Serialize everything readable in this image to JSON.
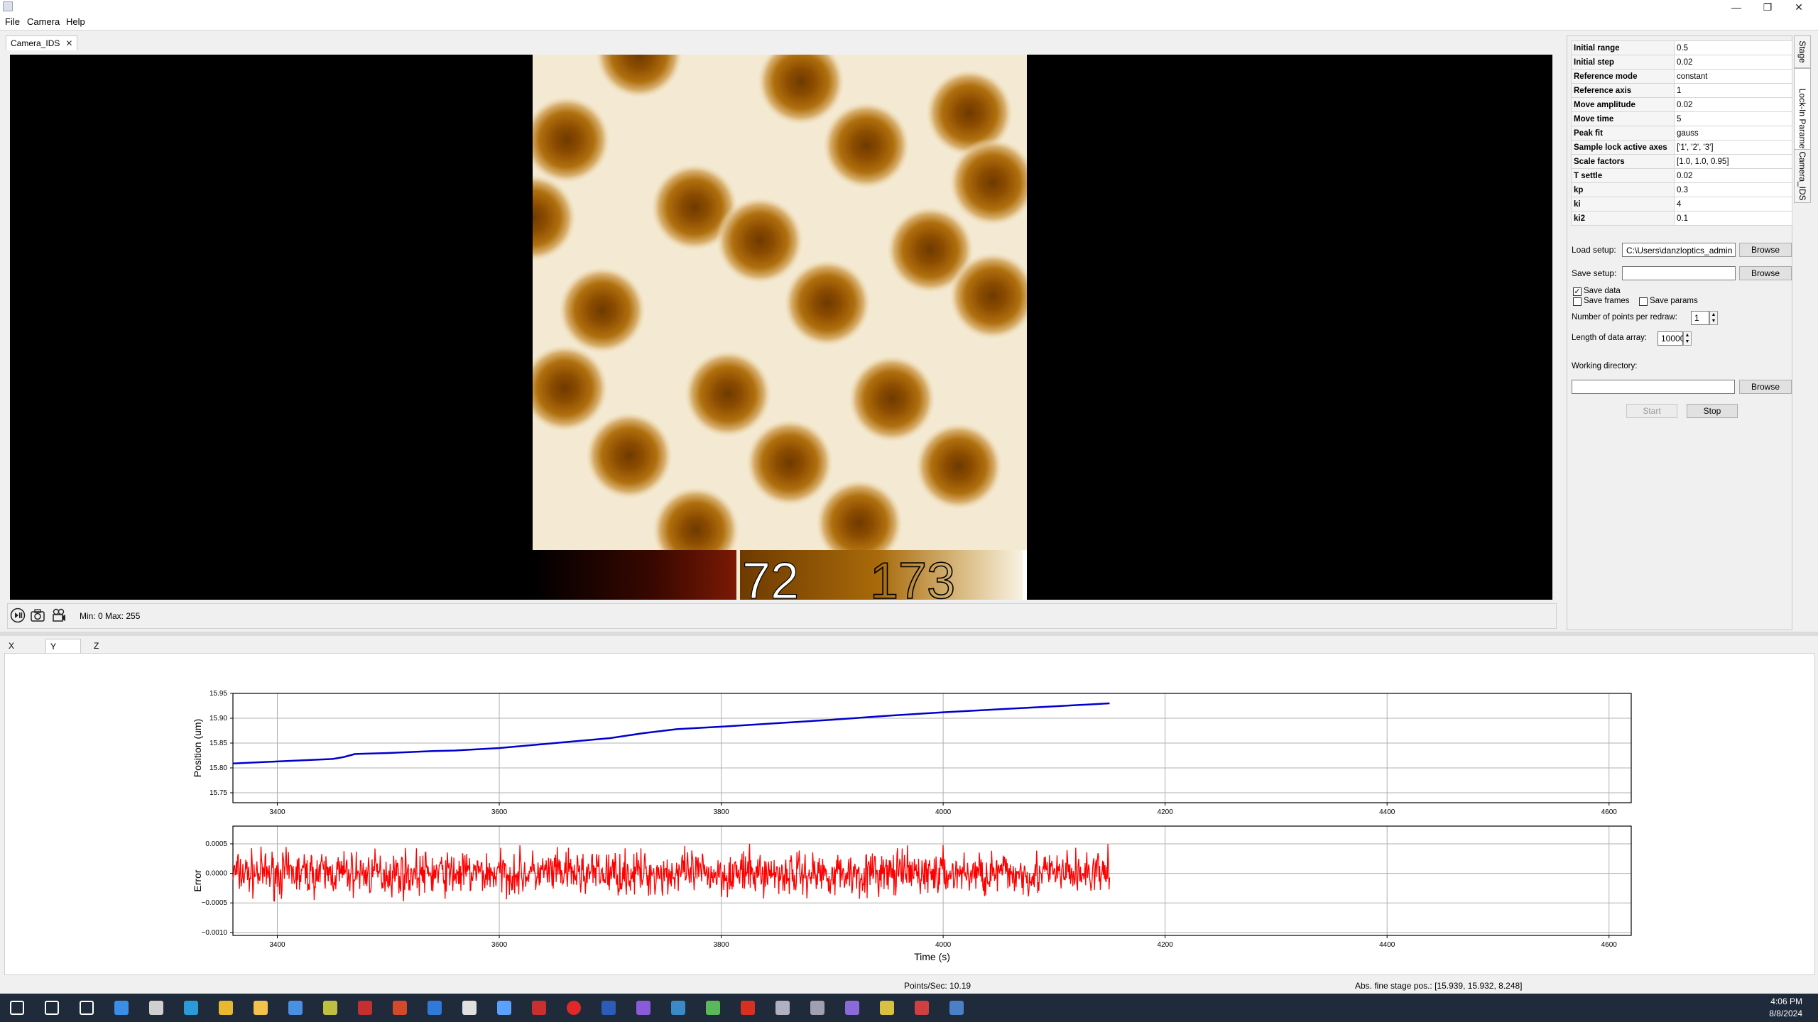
{
  "menu": {
    "file": "File",
    "camera": "Camera",
    "help": "Help"
  },
  "window_controls": {
    "minimize": "—",
    "restore": "❐",
    "close": "✕"
  },
  "camera": {
    "tab_label": "Camera_IDS",
    "tab_close": "✕",
    "colorbar_min_label": "72",
    "colorbar_max_label": "173",
    "min_max_text": "Min: 0 Max: 255"
  },
  "side_tabs": [
    "Stage",
    "Lock-In Parameters",
    "Camera_IDS"
  ],
  "params": [
    {
      "key": "Initial range",
      "value": "0.5"
    },
    {
      "key": "Initial step",
      "value": "0.02"
    },
    {
      "key": "Reference mode",
      "value": "constant"
    },
    {
      "key": "Reference axis",
      "value": "1"
    },
    {
      "key": "Move amplitude",
      "value": "0.02"
    },
    {
      "key": "Move time",
      "value": "5"
    },
    {
      "key": "Peak fit",
      "value": "gauss"
    },
    {
      "key": "Sample lock active axes",
      "value": "['1', '2', '3']"
    },
    {
      "key": "Scale factors",
      "value": "[1.0, 1.0, 0.95]"
    },
    {
      "key": "T settle",
      "value": "0.02"
    },
    {
      "key": "kp",
      "value": "0.3"
    },
    {
      "key": "ki",
      "value": "4"
    },
    {
      "key": "ki2",
      "value": "0.1"
    }
  ],
  "controls": {
    "load_setup_label": "Load setup:",
    "load_setup_value": "C:\\Users\\danzloptics_admin",
    "save_setup_label": "Save setup:",
    "save_setup_value": "",
    "browse": "Browse",
    "save_data": "Save data",
    "save_frames": "Save frames",
    "save_params": "Save params",
    "points_per_redraw_label": "Number of points per redraw:",
    "points_per_redraw": "1",
    "data_array_label": "Length of data array:",
    "data_array": "10000",
    "working_dir_label": "Working directory:",
    "working_dir_value": "",
    "start": "Start",
    "stop": "Stop",
    "save_data_checked": true,
    "save_frames_checked": false,
    "save_params_checked": false
  },
  "plot_tabs": [
    "X Coord.",
    "Y Coord.",
    "Z Coord."
  ],
  "active_plot_tab": 1,
  "status": {
    "points_per_sec": "Points/Sec: 10.19",
    "abs_pos": "Abs. fine stage pos.: [15.939, 15.932, 8.248]"
  },
  "clock": {
    "time": "4:06 PM",
    "date": "8/8/2024"
  },
  "taskbar_icons": [
    "start-icon",
    "search-icon",
    "task-view-icon",
    "app-icon",
    "terminal-icon",
    "edge-icon",
    "chrome-icon",
    "file-explorer-icon",
    "store-icon",
    "app-icon",
    "app-icon",
    "app-icon",
    "vscode-icon",
    "settings-icon",
    "link-icon",
    "app-icon",
    "red-dot-icon",
    "word-icon",
    "visual-studio-icon",
    "app-icon",
    "app-icon",
    "acrobat-icon",
    "app-icon",
    "app-icon",
    "github-icon",
    "app-icon",
    "app-icon",
    "python-icon"
  ],
  "colors": {
    "position_line": "#0000cc",
    "error_line": "#ff0000",
    "taskbar": "#1f2a3a"
  },
  "chart_data": [
    {
      "type": "line",
      "title": "",
      "xlabel": "",
      "ylabel": "Position (um)",
      "xlim": [
        3360,
        4620
      ],
      "ylim": [
        15.73,
        15.95
      ],
      "xticks": [
        3400,
        3600,
        3800,
        4000,
        4200,
        4400,
        4600
      ],
      "yticks": [
        "15.95",
        "15.90",
        "15.85",
        "15.80",
        "15.75"
      ],
      "grid": true,
      "series": [
        {
          "x": [
            3360,
            3400,
            3450,
            3460,
            3470,
            3500,
            3540,
            3560,
            3600,
            3650,
            3700,
            3730,
            3760,
            3800,
            3850,
            3900,
            3950,
            4000,
            4050,
            4100,
            4150
          ],
          "y": [
            15.809,
            15.813,
            15.818,
            15.822,
            15.828,
            15.83,
            15.834,
            15.835,
            15.84,
            15.85,
            15.86,
            15.87,
            15.878,
            15.883,
            15.89,
            15.897,
            15.905,
            15.912,
            15.918,
            15.924,
            15.93
          ]
        }
      ]
    },
    {
      "type": "line",
      "title": "",
      "xlabel": "Time (s)",
      "ylabel": "Error",
      "xlim": [
        3360,
        4620
      ],
      "ylim": [
        -0.00105,
        0.0008
      ],
      "xticks": [
        3400,
        3600,
        3800,
        4000,
        4200,
        4400,
        4600
      ],
      "yticks": [
        "0.0005",
        "0.0000",
        "−0.0005",
        "−0.0010"
      ],
      "grid": true,
      "noise": {
        "x_start": 3360,
        "x_end": 4150,
        "mean": 0.0,
        "amplitude": 0.00055
      }
    }
  ]
}
